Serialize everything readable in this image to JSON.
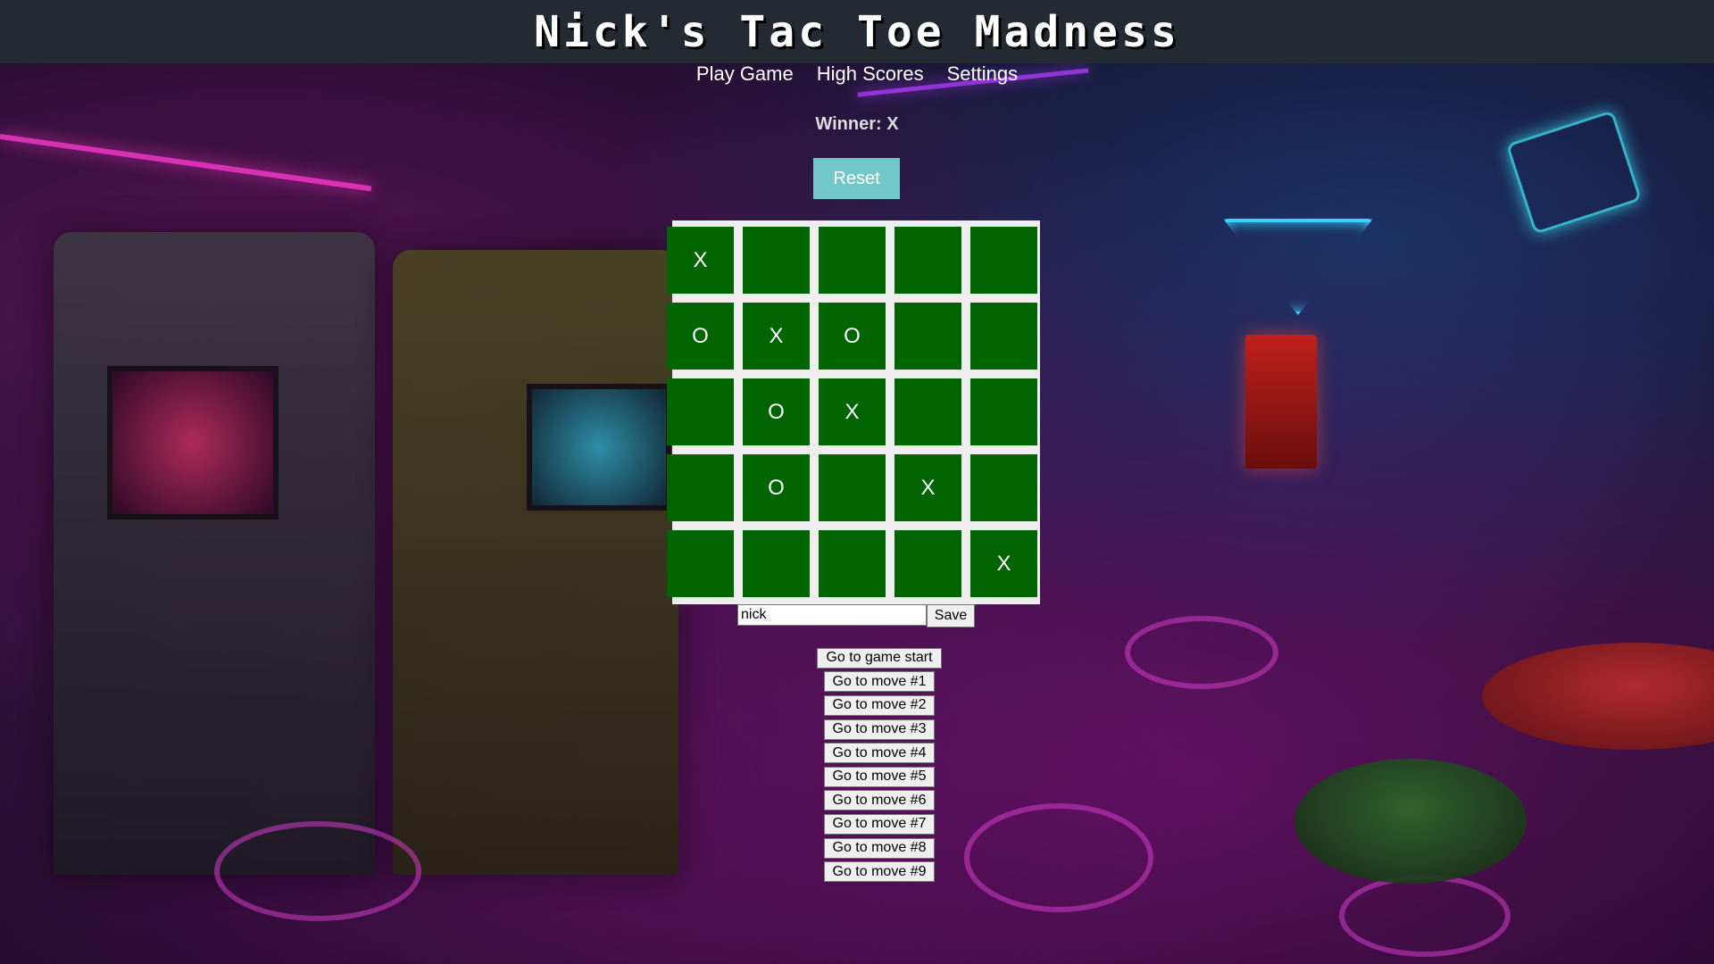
{
  "header": {
    "title": "Nick's Tac Toe Madness"
  },
  "nav": {
    "items": [
      "Play Game",
      "High Scores",
      "Settings"
    ]
  },
  "status": {
    "text": "Winner: X"
  },
  "controls": {
    "reset_label": "Reset",
    "save_label": "Save"
  },
  "board": {
    "rows": 5,
    "cols": 5,
    "cells": [
      [
        "X",
        "",
        "",
        "",
        ""
      ],
      [
        "O",
        "X",
        "O",
        "",
        ""
      ],
      [
        "",
        "O",
        "X",
        "",
        ""
      ],
      [
        "",
        "O",
        "",
        "X",
        ""
      ],
      [
        "",
        "",
        "",
        "",
        "X"
      ]
    ],
    "cell_color": "#006400",
    "board_color": "#eeeeee"
  },
  "name_input": {
    "value": "nick"
  },
  "history": {
    "moves": [
      "Go to game start",
      "Go to move #1",
      "Go to move #2",
      "Go to move #3",
      "Go to move #4",
      "Go to move #5",
      "Go to move #6",
      "Go to move #7",
      "Go to move #8",
      "Go to move #9"
    ]
  },
  "colors": {
    "header_bg": "#232a31",
    "reset_bg": "#72c7c8"
  }
}
